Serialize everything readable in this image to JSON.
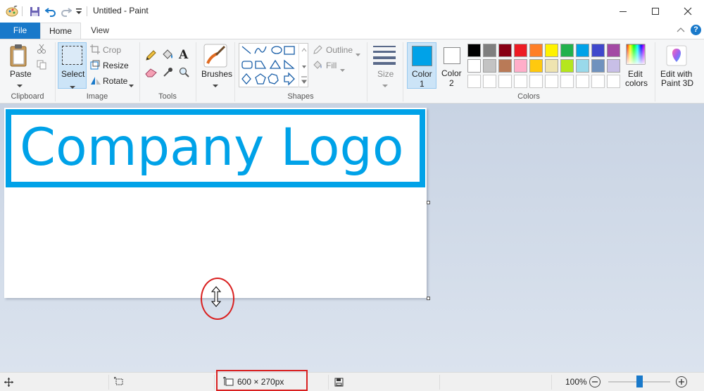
{
  "window": {
    "title": "Untitled - Paint"
  },
  "tabs": {
    "file": "File",
    "home": "Home",
    "view": "View"
  },
  "ribbon": {
    "clipboard": {
      "paste": "Paste",
      "label": "Clipboard"
    },
    "image": {
      "select": "Select",
      "crop": "Crop",
      "resize": "Resize",
      "rotate": "Rotate",
      "label": "Image"
    },
    "tools": {
      "label": "Tools"
    },
    "brushes": {
      "label": "Brushes"
    },
    "shapes": {
      "outline": "Outline",
      "fill": "Fill",
      "label": "Shapes"
    },
    "size": {
      "label": "Size"
    },
    "colors": {
      "color1": "Color",
      "color1_num": "1",
      "color2": "Color",
      "color2_num": "2",
      "edit_colors_1": "Edit",
      "edit_colors_2": "colors",
      "label": "Colors",
      "color1_value": "#00a2e8",
      "color2_value": "#ffffff",
      "palette_row1": [
        "#000000",
        "#7f7f7f",
        "#880015",
        "#ed1c24",
        "#ff7f27",
        "#fff200",
        "#22b14c",
        "#00a2e8",
        "#3f48cc",
        "#a349a4"
      ],
      "palette_row2": [
        "#ffffff",
        "#c3c3c3",
        "#b97a57",
        "#ffaec9",
        "#ffc90e",
        "#efe4b0",
        "#b5e61d",
        "#99d9ea",
        "#7092be",
        "#c8bfe7"
      ]
    },
    "paint3d": {
      "line1": "Edit with",
      "line2": "Paint 3D"
    }
  },
  "canvas": {
    "logo_text": "Company Logo",
    "accent": "#00a2e8"
  },
  "status": {
    "dimensions": "600 × 270px",
    "zoom": "100%",
    "zoom_level": 1.0
  }
}
